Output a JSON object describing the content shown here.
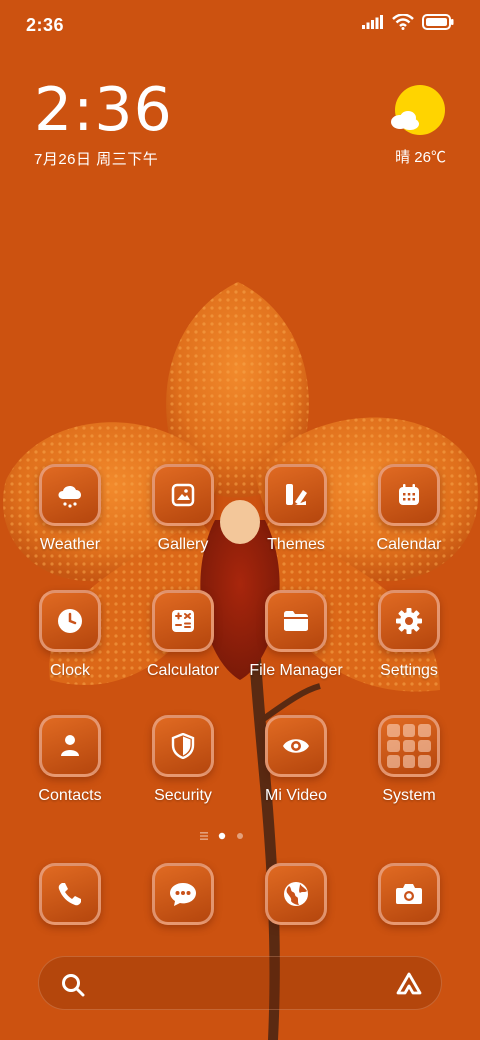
{
  "status_bar": {
    "time": "2:36",
    "icons": [
      "signal-icon",
      "wifi-icon",
      "battery-icon"
    ]
  },
  "clock_widget": {
    "time": "2:36",
    "date": "7月26日 周三下午"
  },
  "weather_widget": {
    "icon": "sunny-cloud-icon",
    "text": "晴 26℃"
  },
  "apps": [
    {
      "label": "Weather",
      "icon": "weather-cloud-icon"
    },
    {
      "label": "Gallery",
      "icon": "gallery-icon"
    },
    {
      "label": "Themes",
      "icon": "themes-icon"
    },
    {
      "label": "Calendar",
      "icon": "calendar-icon"
    },
    {
      "label": "Clock",
      "icon": "clock-icon"
    },
    {
      "label": "Calculator",
      "icon": "calculator-icon"
    },
    {
      "label": "File Manager",
      "icon": "folder-icon"
    },
    {
      "label": "Settings",
      "icon": "gear-icon"
    },
    {
      "label": "Contacts",
      "icon": "contact-icon"
    },
    {
      "label": "Security",
      "icon": "shield-icon"
    },
    {
      "label": "Mi Video",
      "icon": "eye-icon"
    },
    {
      "label": "System",
      "icon": "folder-grid-icon"
    }
  ],
  "page_indicator": {
    "current_page": 1,
    "pages": 2
  },
  "dock": [
    {
      "icon": "phone-icon"
    },
    {
      "icon": "message-icon"
    },
    {
      "icon": "browser-icon"
    },
    {
      "icon": "camera-icon"
    }
  ],
  "search_bar": {
    "icons": [
      "search-icon",
      "assistant-icon"
    ]
  },
  "colors": {
    "background": "#cc5210",
    "tile": "#d05a18",
    "weather_sun": "#ffd400"
  }
}
